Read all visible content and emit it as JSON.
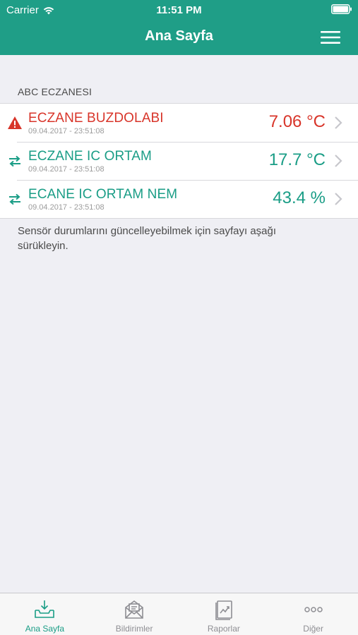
{
  "status": {
    "carrier": "Carrier",
    "time": "11:51 PM"
  },
  "nav": {
    "title": "Ana Sayfa"
  },
  "section": {
    "header": "ABC ECZANESI"
  },
  "sensors": [
    {
      "name": "ECZANE BUZDOLABI",
      "date": "09.04.2017 - 23:51:08",
      "value": "7.06 °C",
      "status": "alert",
      "icon": "warning-icon"
    },
    {
      "name": "ECZANE IC ORTAM",
      "date": "09.04.2017 - 23:51:08",
      "value": "17.7 °C",
      "status": "ok",
      "icon": "transfer-icon"
    },
    {
      "name": "ECANE IC ORTAM NEM",
      "date": "09.04.2017 - 23:51:08",
      "value": "43.4 %",
      "status": "ok",
      "icon": "transfer-icon"
    }
  ],
  "hint": "Sensör durumlarını güncelleyebilmek için sayfayı aşağı sürükleyin.",
  "tabs": [
    {
      "label": "Ana Sayfa",
      "icon": "inbox-download-icon",
      "active": true
    },
    {
      "label": "Bildirimler",
      "icon": "envelope-icon",
      "active": false
    },
    {
      "label": "Raporlar",
      "icon": "report-chart-icon",
      "active": false
    },
    {
      "label": "Diğer",
      "icon": "more-dots-icon",
      "active": false
    }
  ],
  "colors": {
    "accent": "#1f9e87",
    "alert": "#d8352a"
  }
}
